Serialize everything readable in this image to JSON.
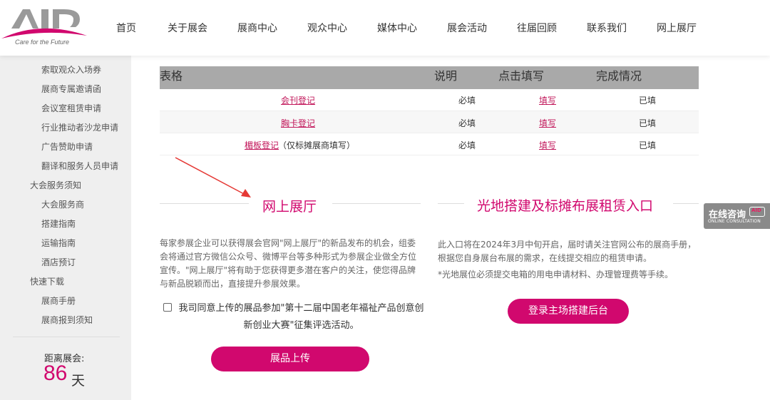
{
  "brand": {
    "logo_text": "AID",
    "tagline": "Care for the Future",
    "accent_color": "#d1086e"
  },
  "nav": {
    "items": [
      "首页",
      "关于展会",
      "展商中心",
      "观众中心",
      "媒体中心",
      "展会活动",
      "往届回顾",
      "联系我们",
      "网上展厅"
    ]
  },
  "sidebar": {
    "items": [
      {
        "label": "索取观众入场券",
        "type": "sub"
      },
      {
        "label": "展商专属邀请函",
        "type": "sub"
      },
      {
        "label": "会议室租赁申请",
        "type": "sub"
      },
      {
        "label": "行业推动者沙龙申请",
        "type": "sub"
      },
      {
        "label": "广告赞助申请",
        "type": "sub"
      },
      {
        "label": "翻译和服务人员申请",
        "type": "sub"
      },
      {
        "label": "大会服务须知",
        "type": "head"
      },
      {
        "label": "大会服务商",
        "type": "sub"
      },
      {
        "label": "搭建指南",
        "type": "sub"
      },
      {
        "label": "运输指南",
        "type": "sub"
      },
      {
        "label": "酒店预订",
        "type": "sub"
      },
      {
        "label": "快速下载",
        "type": "head"
      },
      {
        "label": "展商手册",
        "type": "sub"
      },
      {
        "label": "展商报到须知",
        "type": "sub"
      }
    ],
    "countdown": {
      "label": "距离展会:",
      "days": "86",
      "unit": "天"
    }
  },
  "table": {
    "headers": [
      "表格",
      "说明",
      "点击填写",
      "完成情况"
    ],
    "rows": [
      {
        "form": "会刊登记",
        "form_note": "",
        "required": "必填",
        "action": "填写",
        "status": "已填"
      },
      {
        "form": "胸卡登记",
        "form_note": "",
        "required": "必填",
        "action": "填写",
        "status": "已填"
      },
      {
        "form": "楣板登记",
        "form_note": "（仅标摊展商填写）",
        "required": "必填",
        "action": "填写",
        "status": "已填"
      }
    ]
  },
  "online_hall": {
    "title": "网上展厅",
    "description": "每家参展企业可以获得展会官网\"网上展厅\"的新品发布的机会，组委会将通过官方微信公众号、微博平台等多种形式为参展企业做全方位宣传。\"网上展厅\"将有助于您获得更多潜在客户的关注，使您得品牌与新品脱颖而出，直接提升参展效果。",
    "agree_text": "我司同意上传的展品参加\"第十二届中国老年福祉产品创意创新创业大赛\"征集评选活动。",
    "button": "展品上传"
  },
  "booth_rental": {
    "title": "光地搭建及标摊布展租赁入口",
    "description_1": "此入口将在2024年3月中旬开启，届时请关注官网公布的展商手册，根据您自身展台布展的需求，在线提交相应的租赁申请。",
    "description_2": "*光地展位必须提交电箱的用电申请材料、办理管理费等手续。",
    "button": "登录主场搭建后台"
  },
  "consult": {
    "label": "在线咨询",
    "sub_label": "ONLINE CONSULTATION",
    "icon_text": "AID"
  }
}
